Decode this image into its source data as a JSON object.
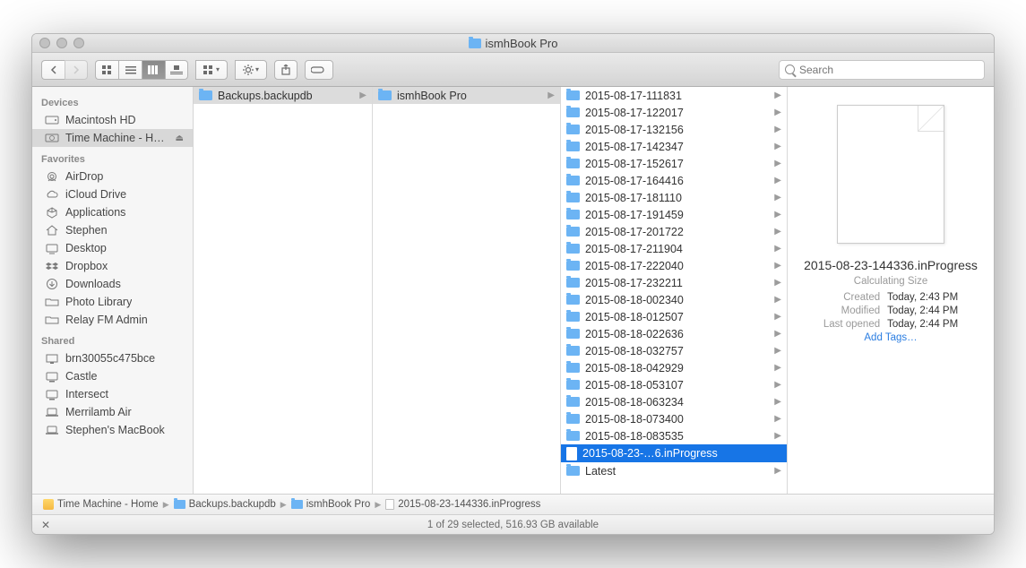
{
  "window": {
    "title": "ismhBook Pro"
  },
  "toolbar": {
    "search_placeholder": "Search"
  },
  "sidebar": {
    "sections": [
      {
        "header": "Devices",
        "items": [
          {
            "icon": "hdd",
            "label": "Macintosh HD"
          },
          {
            "icon": "tm",
            "label": "Time Machine - Home",
            "eject": true,
            "selected": true
          }
        ]
      },
      {
        "header": "Favorites",
        "items": [
          {
            "icon": "airdrop",
            "label": "AirDrop"
          },
          {
            "icon": "cloud",
            "label": "iCloud Drive"
          },
          {
            "icon": "apps",
            "label": "Applications"
          },
          {
            "icon": "home",
            "label": "Stephen"
          },
          {
            "icon": "desktop",
            "label": "Desktop"
          },
          {
            "icon": "dropbox",
            "label": "Dropbox"
          },
          {
            "icon": "downloads",
            "label": "Downloads"
          },
          {
            "icon": "folder",
            "label": "Photo Library"
          },
          {
            "icon": "folder",
            "label": "Relay FM Admin"
          }
        ]
      },
      {
        "header": "Shared",
        "items": [
          {
            "icon": "pc",
            "label": "brn30055c475bce"
          },
          {
            "icon": "mac",
            "label": "Castle"
          },
          {
            "icon": "mac",
            "label": "Intersect"
          },
          {
            "icon": "laptop",
            "label": "Merrilamb Air"
          },
          {
            "icon": "laptop",
            "label": "Stephen's MacBook"
          }
        ]
      }
    ]
  },
  "col1": [
    {
      "label": "Backups.backupdb",
      "selected": true
    }
  ],
  "col2": [
    {
      "label": "ismhBook Pro",
      "selected": true
    }
  ],
  "col3": [
    {
      "type": "folder",
      "label": "2015-08-17-111831"
    },
    {
      "type": "folder",
      "label": "2015-08-17-122017"
    },
    {
      "type": "folder",
      "label": "2015-08-17-132156"
    },
    {
      "type": "folder",
      "label": "2015-08-17-142347"
    },
    {
      "type": "folder",
      "label": "2015-08-17-152617"
    },
    {
      "type": "folder",
      "label": "2015-08-17-164416"
    },
    {
      "type": "folder",
      "label": "2015-08-17-181110"
    },
    {
      "type": "folder",
      "label": "2015-08-17-191459"
    },
    {
      "type": "folder",
      "label": "2015-08-17-201722"
    },
    {
      "type": "folder",
      "label": "2015-08-17-211904"
    },
    {
      "type": "folder",
      "label": "2015-08-17-222040"
    },
    {
      "type": "folder",
      "label": "2015-08-17-232211"
    },
    {
      "type": "folder",
      "label": "2015-08-18-002340"
    },
    {
      "type": "folder",
      "label": "2015-08-18-012507"
    },
    {
      "type": "folder",
      "label": "2015-08-18-022636"
    },
    {
      "type": "folder",
      "label": "2015-08-18-032757"
    },
    {
      "type": "folder",
      "label": "2015-08-18-042929"
    },
    {
      "type": "folder",
      "label": "2015-08-18-053107"
    },
    {
      "type": "folder",
      "label": "2015-08-18-063234"
    },
    {
      "type": "folder",
      "label": "2015-08-18-073400"
    },
    {
      "type": "folder",
      "label": "2015-08-18-083535"
    },
    {
      "type": "file",
      "label": "2015-08-23-…6.inProgress",
      "selected": true
    },
    {
      "type": "folder",
      "label": "Latest"
    }
  ],
  "preview": {
    "name": "2015-08-23-144336.inProgress",
    "calc": "Calculating Size",
    "created_k": "Created",
    "created_v": "Today, 2:43 PM",
    "modified_k": "Modified",
    "modified_v": "Today, 2:44 PM",
    "opened_k": "Last opened",
    "opened_v": "Today, 2:44 PM",
    "tags": "Add Tags…"
  },
  "pathbar": [
    {
      "icon": "drive",
      "label": "Time Machine - Home"
    },
    {
      "icon": "folder",
      "label": "Backups.backupdb"
    },
    {
      "icon": "folder",
      "label": "ismhBook Pro"
    },
    {
      "icon": "file",
      "label": "2015-08-23-144336.inProgress"
    }
  ],
  "status": "1 of 29 selected, 516.93 GB available"
}
